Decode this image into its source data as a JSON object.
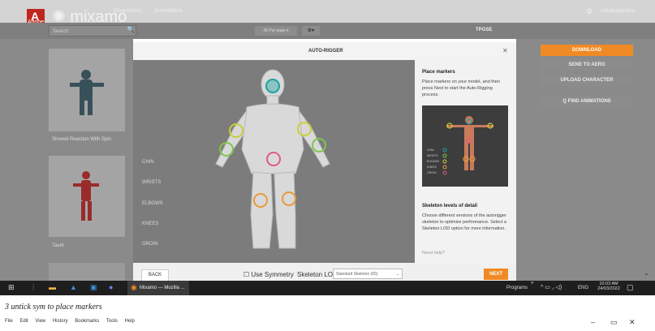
{
  "app": {
    "brand": "Adobe",
    "logo": "mixamo",
    "nav": [
      "Characters",
      "Animations"
    ],
    "user_label": "nalaisalamlua"
  },
  "toolbar": {
    "search_placeholder": "Search",
    "per_page": "48 Per page",
    "pose_label": "TPOSE"
  },
  "gallery": {
    "items": [
      {
        "label": "Shoved Reaction With Spin"
      },
      {
        "label": "Taunt"
      }
    ]
  },
  "right_panel": {
    "download": "DOWNLOAD",
    "send_to_aero": "SEND TO AERO",
    "upload": "UPLOAD CHARACTER",
    "find": "Q FIND ANIMATIONS"
  },
  "modal": {
    "title": "AUTO-RIGGER",
    "marker_labels": [
      "CHIN",
      "WRISTS",
      "ELBOWS",
      "KNEES",
      "GROIN"
    ],
    "side": {
      "heading1": "Place markers",
      "text1": "Place markers on your model, and then press Next to start the Auto-Rigging process.",
      "thumb_labels": [
        "CHIN",
        "WRISTS",
        "ELBOWS",
        "KNEES",
        "GROIN"
      ],
      "heading2": "Skeleton levels of detail",
      "text2": "Choose different versions of the autorigger skeleton to optimize performance. Select a Skeleton LOD option for more information.",
      "help": "Need help?"
    },
    "footer": {
      "back": "BACK",
      "symmetry": "Use Symmetry",
      "lod_label": "Skeleton LOD",
      "lod_value": "Standard Skeleton (65)",
      "next": "NEXT"
    }
  },
  "taskbar": {
    "firefox_label": "Mixamo — Mozilla ...",
    "programs": "Programs",
    "lang": "ENG",
    "time": "10:03 AM",
    "date": "24/03/2022"
  },
  "caption": "3 untick sym to place markers",
  "menu": [
    "File",
    "Edit",
    "View",
    "History",
    "Bookmarks",
    "Tools",
    "Help"
  ],
  "colors": {
    "accent": "#f08a24",
    "adobe_red": "#c0261e"
  }
}
